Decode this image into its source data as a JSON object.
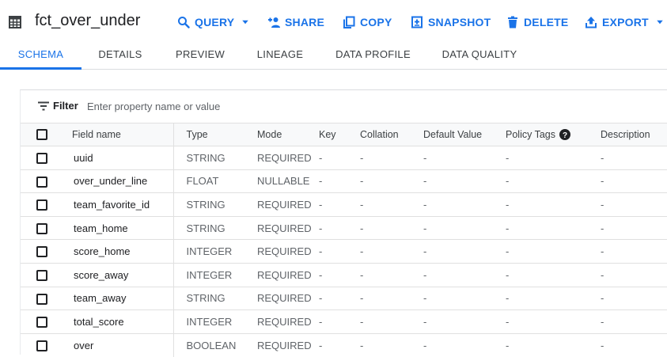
{
  "header": {
    "title": "fct_over_under",
    "actions": [
      {
        "label": "QUERY",
        "icon": "search-icon"
      },
      {
        "label": "SHARE",
        "icon": "person-add-icon"
      },
      {
        "label": "COPY",
        "icon": "copy-icon"
      },
      {
        "label": "SNAPSHOT",
        "icon": "snapshot-icon"
      },
      {
        "label": "DELETE",
        "icon": "trash-icon"
      },
      {
        "label": "EXPORT",
        "icon": "upload-icon"
      }
    ]
  },
  "tabs": [
    {
      "label": "SCHEMA",
      "active": true
    },
    {
      "label": "DETAILS",
      "active": false
    },
    {
      "label": "PREVIEW",
      "active": false
    },
    {
      "label": "LINEAGE",
      "active": false
    },
    {
      "label": "DATA PROFILE",
      "active": false
    },
    {
      "label": "DATA QUALITY",
      "active": false
    }
  ],
  "filter": {
    "label": "Filter",
    "placeholder": "Enter property name or value"
  },
  "table": {
    "columns": [
      "Field name",
      "Type",
      "Mode",
      "Key",
      "Collation",
      "Default Value",
      "Policy Tags",
      "Description"
    ],
    "rows": [
      {
        "name": "uuid",
        "type": "STRING",
        "mode": "REQUIRED",
        "key": "-",
        "collation": "-",
        "default": "-",
        "policy": "-",
        "description": "-"
      },
      {
        "name": "over_under_line",
        "type": "FLOAT",
        "mode": "NULLABLE",
        "key": "-",
        "collation": "-",
        "default": "-",
        "policy": "-",
        "description": "-"
      },
      {
        "name": "team_favorite_id",
        "type": "STRING",
        "mode": "REQUIRED",
        "key": "-",
        "collation": "-",
        "default": "-",
        "policy": "-",
        "description": "-"
      },
      {
        "name": "team_home",
        "type": "STRING",
        "mode": "REQUIRED",
        "key": "-",
        "collation": "-",
        "default": "-",
        "policy": "-",
        "description": "-"
      },
      {
        "name": "score_home",
        "type": "INTEGER",
        "mode": "REQUIRED",
        "key": "-",
        "collation": "-",
        "default": "-",
        "policy": "-",
        "description": "-"
      },
      {
        "name": "score_away",
        "type": "INTEGER",
        "mode": "REQUIRED",
        "key": "-",
        "collation": "-",
        "default": "-",
        "policy": "-",
        "description": "-"
      },
      {
        "name": "team_away",
        "type": "STRING",
        "mode": "REQUIRED",
        "key": "-",
        "collation": "-",
        "default": "-",
        "policy": "-",
        "description": "-"
      },
      {
        "name": "total_score",
        "type": "INTEGER",
        "mode": "REQUIRED",
        "key": "-",
        "collation": "-",
        "default": "-",
        "policy": "-",
        "description": "-"
      },
      {
        "name": "over",
        "type": "BOOLEAN",
        "mode": "REQUIRED",
        "key": "-",
        "collation": "-",
        "default": "-",
        "policy": "-",
        "description": "-"
      }
    ]
  },
  "colors": {
    "accent": "#1a73e8",
    "text": "#202124",
    "muted": "#5f6368",
    "divider": "#e0e0e0"
  }
}
